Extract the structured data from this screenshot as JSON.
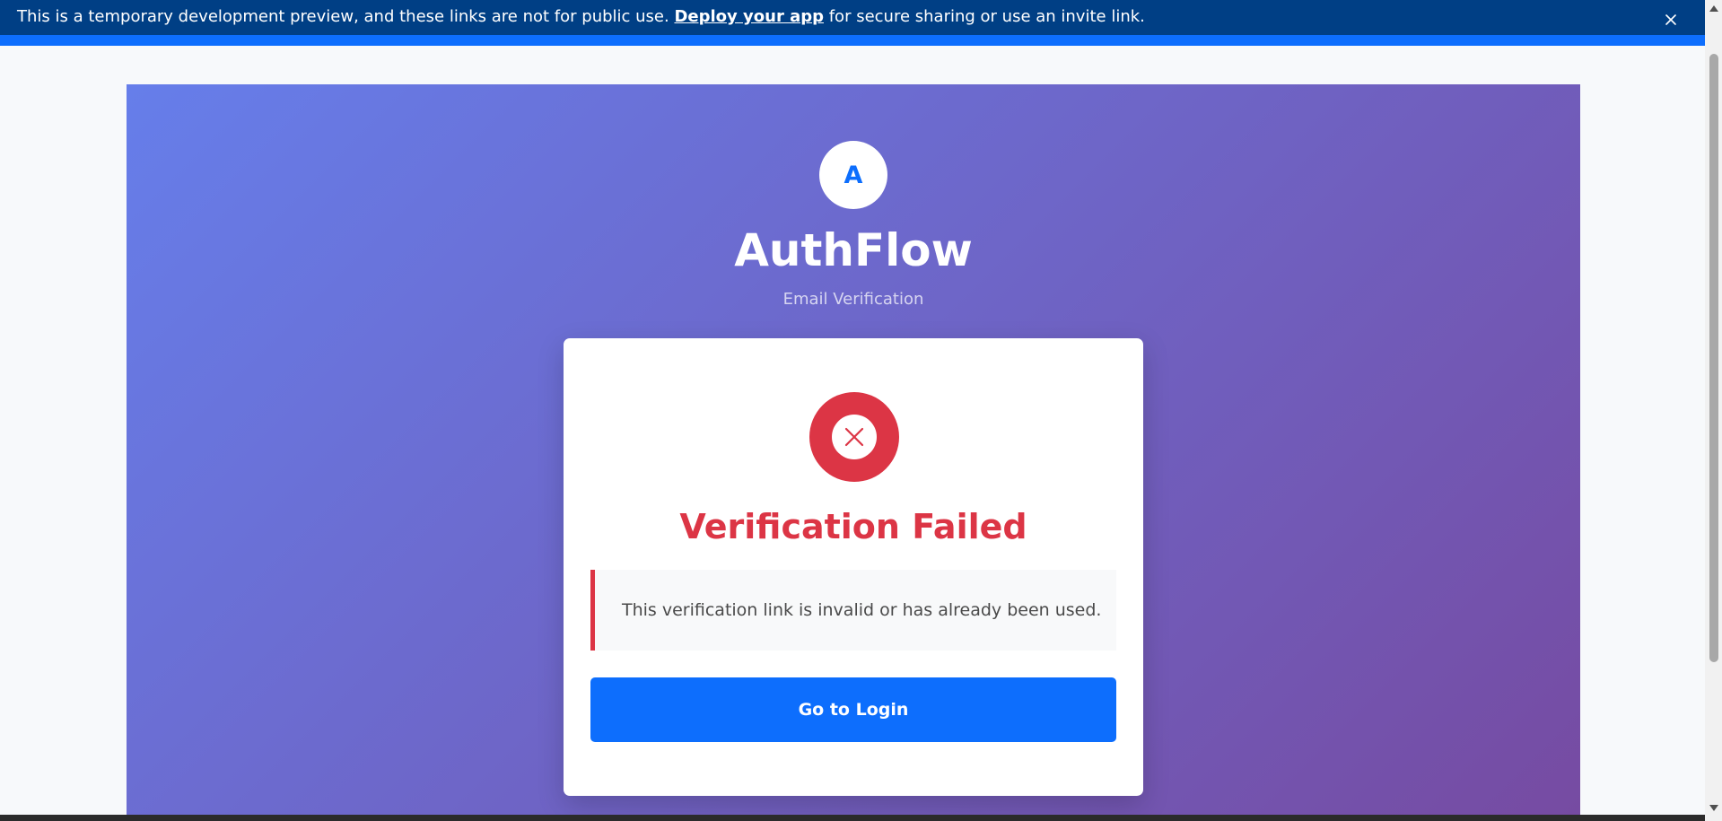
{
  "banner": {
    "message_before": "This is a temporary development preview, and these links are not for public use. ",
    "link_label": "Deploy your app",
    "message_after": " for secure sharing or use an invite link.",
    "close_icon": "close-icon",
    "background_color": "#003f85",
    "accent_color": "#0d6efd"
  },
  "app": {
    "logo_letter": "A",
    "title": "AuthFlow",
    "subtitle": "Email Verification",
    "gradient_start": "#667eea",
    "gradient_end": "#764ba2"
  },
  "card": {
    "status_icon": "error-x-icon",
    "title": "Verification Failed",
    "message": "This verification link is invalid or has already been used.",
    "button_label": "Go to Login",
    "error_color": "#dc3545",
    "button_color": "#0d6efd"
  }
}
